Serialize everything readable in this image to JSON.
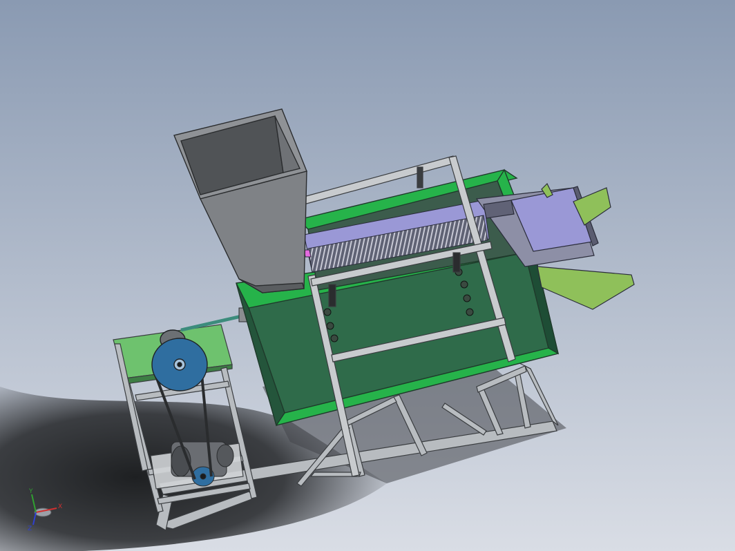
{
  "viewport": {
    "background_top": "#8a9ab2",
    "background_bottom": "#d9dde5"
  },
  "colors": {
    "frame": "#b8bcc0",
    "frame_edge": "#3a3d40",
    "tank_green": "#2f6b4a",
    "tank_rim": "#26b34a",
    "hopper": "#7f8286",
    "hopper_dark": "#505356",
    "belt_grey": "#8d8fa6",
    "lavender": "#9a98d6",
    "chute_green": "#8fc05a",
    "motor_stand_top": "#6ec26e",
    "pulley_blue": "#2f6ea0",
    "shadow": "#2b2d30"
  },
  "triad": {
    "x_label": "X",
    "y_label": "Y",
    "z_label": "Z",
    "x_color": "#d03030",
    "y_color": "#30a030",
    "z_color": "#3040d0"
  }
}
